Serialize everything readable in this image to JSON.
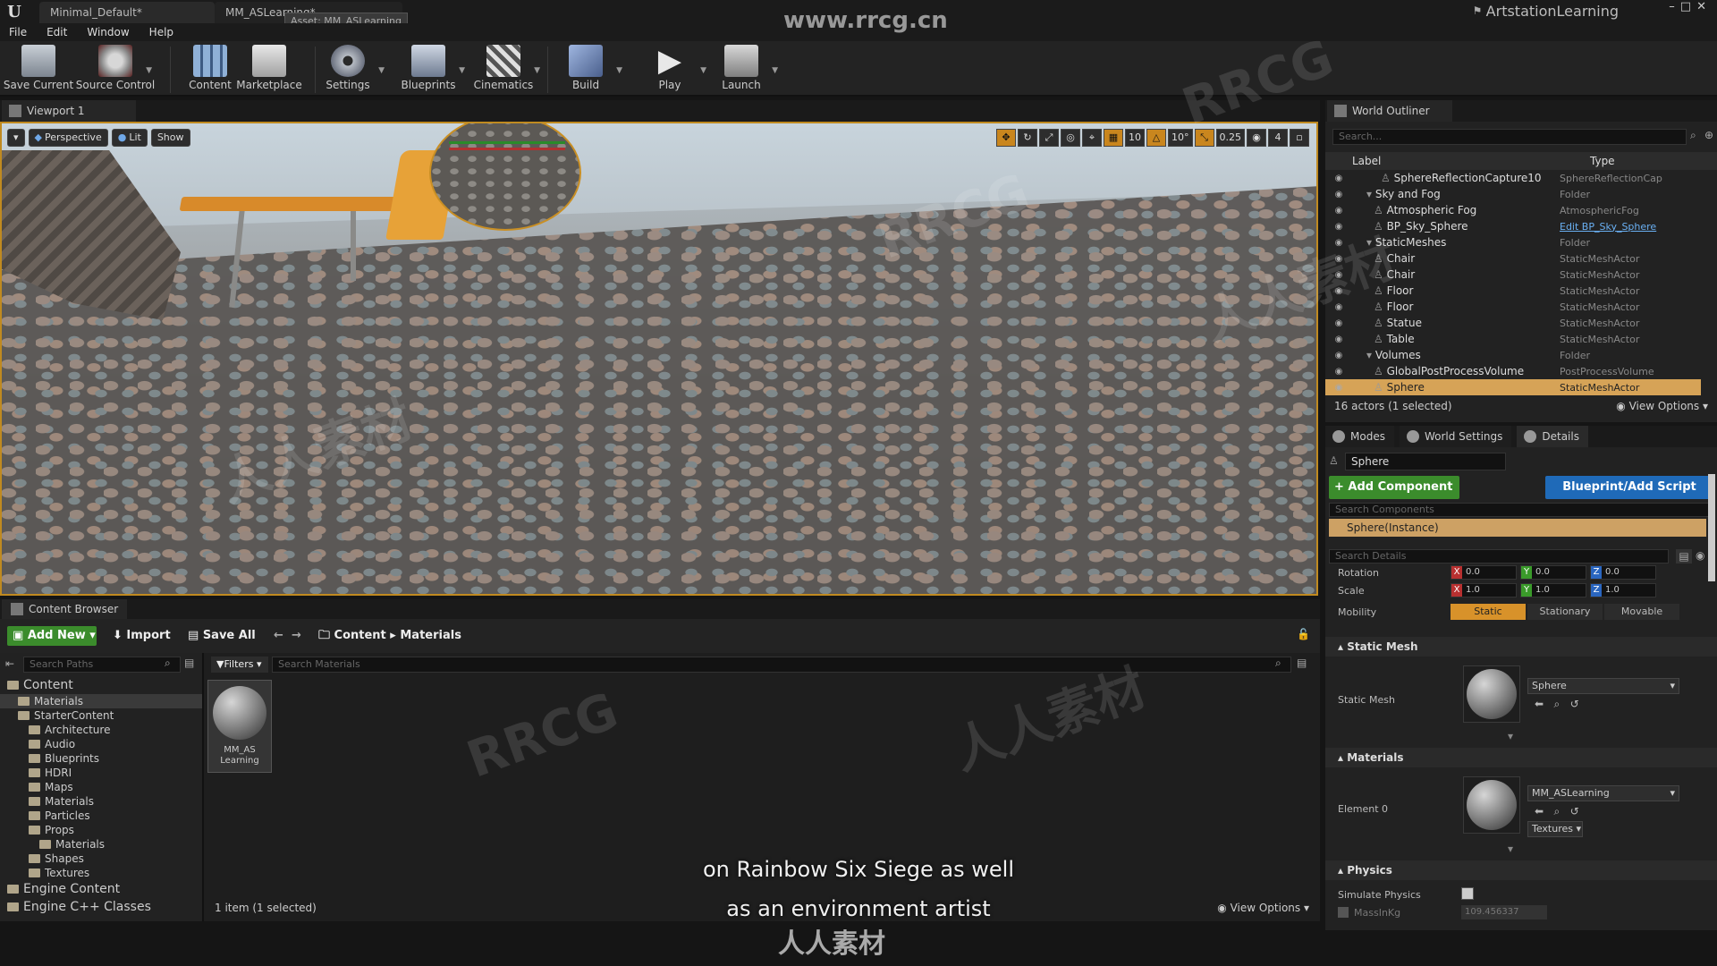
{
  "window": {
    "tabs": [
      "Minimal_Default*",
      "MM_ASLearning*"
    ],
    "tooltip": "Asset: MM_ASLearning",
    "project": "ArtstationLearning"
  },
  "menu": [
    "File",
    "Edit",
    "Window",
    "Help"
  ],
  "toolbar": {
    "buttons": [
      "Save Current",
      "Source Control",
      "Content",
      "Marketplace",
      "Settings",
      "Blueprints",
      "Cinematics",
      "Build",
      "Play",
      "Launch"
    ]
  },
  "viewport": {
    "tab": "Viewport 1",
    "mode_perspective": "Perspective",
    "mode_lit": "Lit",
    "mode_show": "Show",
    "grid_snap": "10",
    "rotation_snap": "10°",
    "scale_snap": "0.25",
    "camera_speed": "4"
  },
  "outliner": {
    "tab": "World Outliner",
    "search_placeholder": "Search...",
    "col_label": "Label",
    "col_type": "Type",
    "rows": [
      {
        "label": "SphereReflectionCapture10",
        "type": "SphereReflectionCap"
      },
      {
        "label": "Sky and Fog",
        "type": "Folder"
      },
      {
        "label": "Atmospheric Fog",
        "type": "AtmosphericFog"
      },
      {
        "label": "BP_Sky_Sphere",
        "type": "Edit BP_Sky_Sphere"
      },
      {
        "label": "StaticMeshes",
        "type": "Folder"
      },
      {
        "label": "Chair",
        "type": "StaticMeshActor"
      },
      {
        "label": "Chair",
        "type": "StaticMeshActor"
      },
      {
        "label": "Floor",
        "type": "StaticMeshActor"
      },
      {
        "label": "Floor",
        "type": "StaticMeshActor"
      },
      {
        "label": "Statue",
        "type": "StaticMeshActor"
      },
      {
        "label": "Table",
        "type": "StaticMeshActor"
      },
      {
        "label": "Volumes",
        "type": "Folder"
      },
      {
        "label": "GlobalPostProcessVolume",
        "type": "PostProcessVolume"
      },
      {
        "label": "Sphere",
        "type": "StaticMeshActor"
      }
    ],
    "footer_count": "16 actors (1 selected)",
    "view_options": "View Options"
  },
  "details": {
    "tabs": [
      "Modes",
      "World Settings",
      "Details"
    ],
    "actor_name": "Sphere",
    "add_component": "+ Add Component",
    "blueprint_script": "Blueprint/Add Script",
    "search_components": "Search Components",
    "component_instance": "Sphere(Instance)",
    "search_details": "Search Details",
    "rotation_label": "Rotation",
    "rotation": {
      "x": "0.0",
      "y": "0.0",
      "z": "0.0"
    },
    "scale_label": "Scale",
    "scale": {
      "x": "1.0",
      "y": "1.0",
      "z": "1.0"
    },
    "mobility_label": "Mobility",
    "mobility": [
      "Static",
      "Stationary",
      "Movable"
    ],
    "section_static_mesh": "Static Mesh",
    "static_mesh_label": "Static Mesh",
    "static_mesh_value": "Sphere",
    "section_materials": "Materials",
    "element0_label": "Element 0",
    "element0_value": "MM_ASLearning",
    "textures": "Textures",
    "section_physics": "Physics",
    "simulate_physics": "Simulate Physics",
    "mass_label": "MassInKg",
    "mass_value": "109.456337"
  },
  "content_browser": {
    "tab": "Content Browser",
    "add_new": "Add New",
    "import": "Import",
    "save_all": "Save All",
    "breadcrumb": [
      "Content",
      "Materials"
    ],
    "search_paths": "Search Paths",
    "filters": "Filters",
    "search_materials": "Search Materials",
    "tree": [
      {
        "label": "Content",
        "depth": 0
      },
      {
        "label": "Materials",
        "depth": 1
      },
      {
        "label": "StarterContent",
        "depth": 1
      },
      {
        "label": "Architecture",
        "depth": 2
      },
      {
        "label": "Audio",
        "depth": 2
      },
      {
        "label": "Blueprints",
        "depth": 2
      },
      {
        "label": "HDRI",
        "depth": 2
      },
      {
        "label": "Maps",
        "depth": 2
      },
      {
        "label": "Materials",
        "depth": 2
      },
      {
        "label": "Particles",
        "depth": 2
      },
      {
        "label": "Props",
        "depth": 2
      },
      {
        "label": "Materials",
        "depth": 3
      },
      {
        "label": "Shapes",
        "depth": 2
      },
      {
        "label": "Textures",
        "depth": 2
      },
      {
        "label": "Engine Content",
        "depth": 0
      },
      {
        "label": "Engine C++ Classes",
        "depth": 0
      }
    ],
    "asset_name": "MM_AS Learning",
    "status": "1 item (1 selected)",
    "view_options": "View Options"
  },
  "overlay": {
    "subtitle_line1": "on Rainbow Six Siege as well",
    "subtitle_line2": "as an environment artist",
    "site_watermark": "www.rrcg.cn",
    "bottom_logo": "人人素材",
    "watermarks": [
      "RRCG",
      "人人素材",
      "RRCG",
      "人人素材",
      "RRCG",
      "人人素材"
    ]
  }
}
